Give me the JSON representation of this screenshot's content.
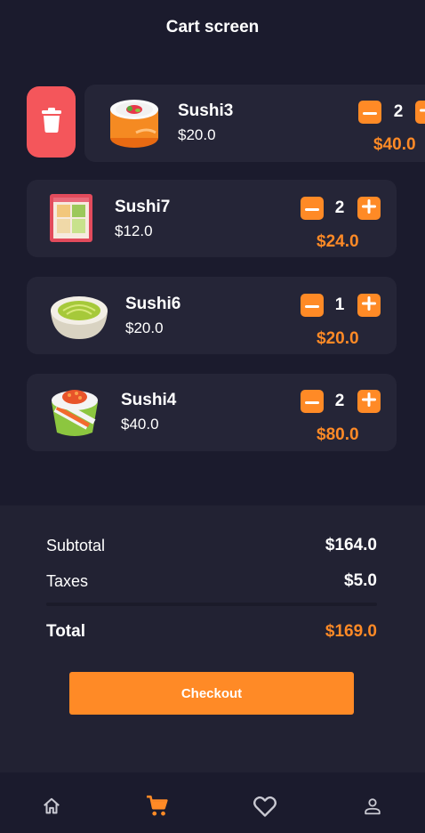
{
  "header": {
    "title": "Cart screen"
  },
  "cart": {
    "items": [
      {
        "name": "Sushi3",
        "price": "$20.0",
        "qty": "2",
        "total": "$40.0",
        "image_icon": "sushi-roll-salmon-icon"
      },
      {
        "name": "Sushi7",
        "price": "$12.0",
        "qty": "2",
        "total": "$24.0",
        "image_icon": "sushi-box-icon"
      },
      {
        "name": "Sushi6",
        "price": "$20.0",
        "qty": "1",
        "total": "$20.0",
        "image_icon": "wasabi-bowl-icon"
      },
      {
        "name": "Sushi4",
        "price": "$40.0",
        "qty": "2",
        "total": "$80.0",
        "image_icon": "sushi-roll-green-icon"
      }
    ],
    "swipe_action_icon": "trash-icon"
  },
  "summary": {
    "subtotal_label": "Subtotal",
    "subtotal_value": "$164.0",
    "taxes_label": "Taxes",
    "taxes_value": "$5.0",
    "total_label": "Total",
    "total_value": "$169.0"
  },
  "checkout": {
    "label": "Checkout"
  },
  "nav": {
    "items": [
      {
        "icon": "home-icon",
        "active": false
      },
      {
        "icon": "cart-icon",
        "active": true
      },
      {
        "icon": "heart-icon",
        "active": false
      },
      {
        "icon": "profile-icon",
        "active": false
      }
    ]
  },
  "colors": {
    "background": "#1b1b2d",
    "card": "#252537",
    "accent": "#ff8a26",
    "danger": "#f4565b",
    "nav_inactive": "#c9c9d2"
  }
}
